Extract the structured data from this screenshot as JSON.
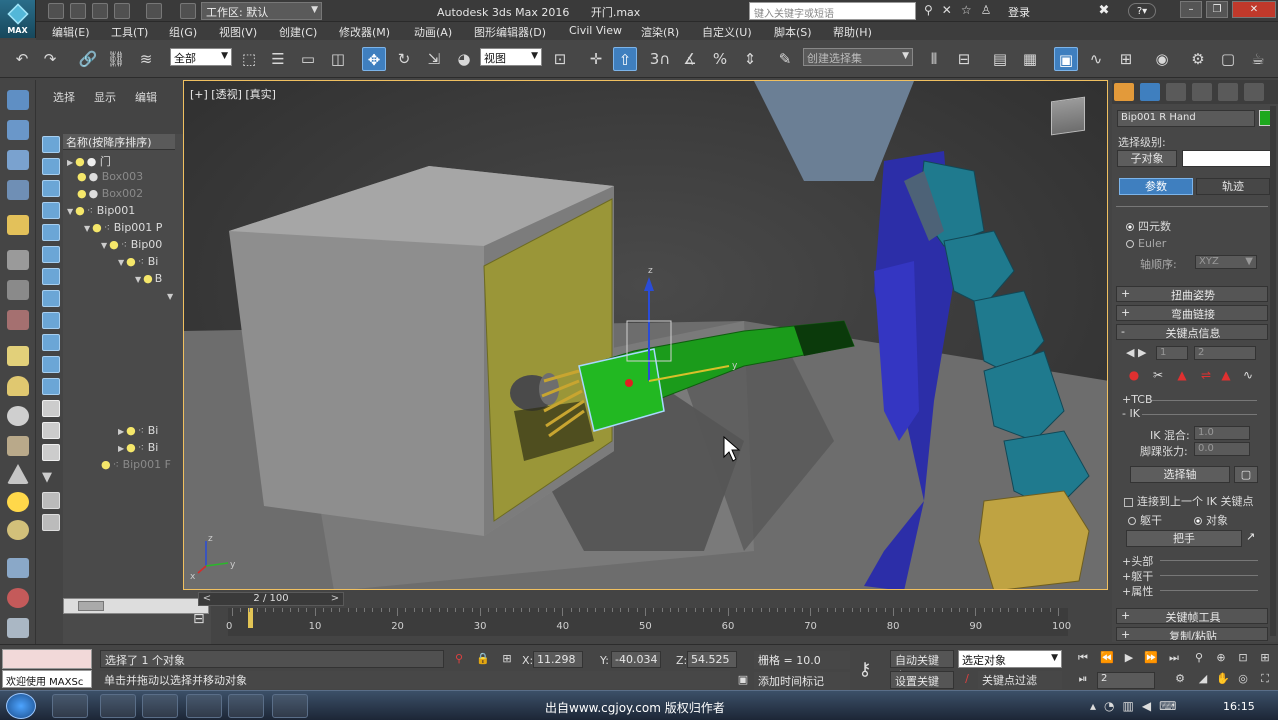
{
  "app": {
    "logo_text": "MAX",
    "workspace_value": "工作区: 默认",
    "app_name": "Autodesk 3ds Max 2016",
    "file_name": "开门.max",
    "search_placeholder": "键入关键字或短语",
    "login_label": "登录"
  },
  "menu": [
    "编辑(E)",
    "工具(T)",
    "组(G)",
    "视图(V)",
    "创建(C)",
    "修改器(M)",
    "动画(A)",
    "图形编辑器(D)",
    "Civil View",
    "渲染(R)",
    "自定义(U)",
    "脚本(S)",
    "帮助(H)"
  ],
  "toolbar": {
    "filter_dropdown": "全部",
    "refcoord_dropdown": "视图",
    "named_selection": "创建选择集",
    "snap_label": "3"
  },
  "explorer": {
    "tabs": [
      "选择",
      "显示",
      "编辑"
    ],
    "column_header": "名称(按降序排序)",
    "rows": [
      "门",
      "Box003",
      "Box002",
      "Bip001",
      "Bip001 P",
      "Bip00",
      "Bi",
      "B",
      "Bi",
      "Bi",
      "Bip001 F"
    ]
  },
  "viewport": {
    "label": "[+] [透视] [真实]",
    "axis_x": "x",
    "axis_y": "y",
    "axis_z": "z"
  },
  "command_panel": {
    "object_name": "Bip001 R Hand",
    "object_color": "#1ea81e",
    "selection_level_label": "选择级别:",
    "sub_object_button": "子对象",
    "tab_params": "参数",
    "tab_trajectory": "轨迹",
    "quaternion": "四元数",
    "euler": "Euler",
    "axis_order_label": "轴顺序:",
    "axis_order_value": "XYZ",
    "rollout_twist": "扭曲姿势",
    "rollout_bend": "弯曲链接",
    "rollout_keyinfo": "关键点信息",
    "key_prev": "1",
    "key_next": "2",
    "tcb": "+TCB",
    "ik": "- IK",
    "ik_blend_label": "IK 混合:",
    "ik_blend_value": "1.0",
    "ankle_label": "脚踝张力:",
    "ankle_value": "0.0",
    "select_pivot": "选择轴",
    "join_prev_ik": "连接到上一个 IK 关键点",
    "body": "躯干",
    "object": "对象",
    "hand": "把手",
    "head": "+头部",
    "torso": "+躯干",
    "props": "+属性",
    "rollout_keytools": "关键帧工具",
    "rollout_copy": "复制/粘贴"
  },
  "timeline": {
    "slider_label": "2 / 100",
    "ticks": [
      "0",
      "10",
      "20",
      "30",
      "40",
      "50",
      "60",
      "70",
      "80",
      "90",
      "100"
    ]
  },
  "status": {
    "welcome": "欢迎使用 MAXSc",
    "selection_msg": "选择了 1 个对象",
    "prompt_msg": "单击并拖动以选择并移动对象",
    "x_label": "X:",
    "x_value": "11.298",
    "y_label": "Y:",
    "y_value": "-40.034",
    "z_label": "Z:",
    "z_value": "54.525",
    "grid": "栅格 = 10.0",
    "add_time_tag": "添加时间标记",
    "auto_key": "自动关键点",
    "set_key": "设置关键点",
    "selected_object": "选定对象",
    "key_filters": "关键点过滤器...",
    "frame_value": "2"
  },
  "taskbar": {
    "watermark": "出自www.cgjoy.com 版权归作者",
    "clock": "16:15"
  }
}
